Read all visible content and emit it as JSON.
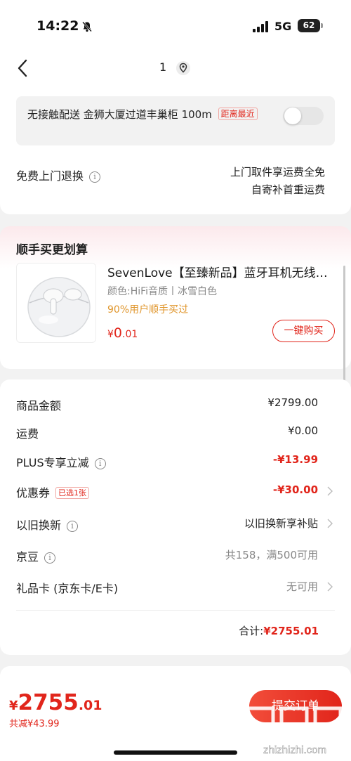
{
  "status_bar": {
    "time": "14:22",
    "network": "5G",
    "battery": "62",
    "icons": [
      "bell-muted-icon",
      "signal-icon"
    ]
  },
  "nav": {
    "count": "1",
    "icons": [
      "back-icon",
      "location-icon"
    ]
  },
  "delivery": {
    "locker_text": "无接触配送  金狮大厦过道丰巢柜",
    "distance": "100m",
    "nearest_badge": "距离最近",
    "toggle_on": false,
    "return_label": "免费上门退换",
    "return_desc_line1": "上门取件享运费全免",
    "return_desc_line2": "自寄补首重运费"
  },
  "recommend": {
    "title": "顺手买更划算",
    "product_name": "SevenLove【至臻新品】蓝牙耳机无线…",
    "product_spec": "颜色:HiFi音质丨冰雪白色",
    "buy_stat": "90%用户顺手买过",
    "price_symbol": "¥",
    "price_int": "0",
    "price_dec": ".01",
    "buy_button": "一键购买"
  },
  "price_details": {
    "rows": [
      {
        "label": "商品金额",
        "value": "¥2799.00"
      },
      {
        "label": "运费",
        "value": "¥0.00"
      },
      {
        "label": "PLUS专享立减",
        "value": "-¥13.99"
      },
      {
        "label": "优惠券",
        "badge": "已选1张",
        "value": "-¥30.00"
      },
      {
        "label": "以旧换新",
        "value": "以旧换新享补贴"
      },
      {
        "label": "京豆",
        "value": "共158，满500可用"
      },
      {
        "label": "礼品卡 (京东卡/E卡)",
        "value": "无可用"
      }
    ],
    "total_label": "合计:",
    "total_amount": "¥2755.01"
  },
  "bottom": {
    "price_symbol": "¥",
    "price_int": "2755",
    "price_dec": ".01",
    "saved": "共减¥43.99",
    "submit": "提交订单",
    "watermark": "zhizhizhi.com"
  },
  "colors": {
    "accent": "#e1251b",
    "orange": "#e0962c",
    "page_bg": "#f2f2f2"
  }
}
